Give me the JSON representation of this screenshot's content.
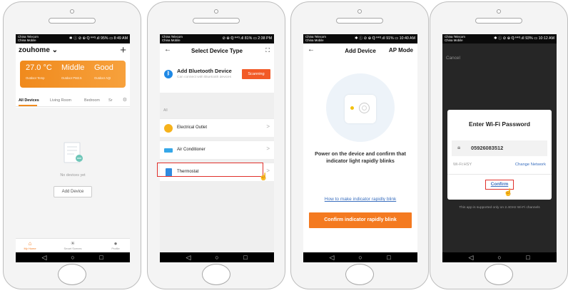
{
  "phones": [
    {
      "status": {
        "carrier": "China Telecom\nChina Mobile",
        "right": "✱ ⓘ ⊘ ⊕ ℚ ᴴ⁴ᴳ.ıll 95% ▭ 8:49 AM"
      },
      "home": {
        "title": "zouhome ⌄",
        "plus_icon": "+",
        "weather": [
          {
            "value": "27.0 °C",
            "label": "Outdoor Temp"
          },
          {
            "value": "Middle",
            "label": "Outdoor PM2.5"
          },
          {
            "value": "Good",
            "label": "Outdoor AQI"
          }
        ],
        "tabs": [
          "All Devices",
          "Living Room",
          "Bedroom",
          "Sr"
        ],
        "empty_text": "No devices yet",
        "add_device": "Add Device",
        "tabbar": [
          {
            "icon": "house-icon",
            "label": "My Home"
          },
          {
            "icon": "sun-icon",
            "label": "Smart Scenes"
          },
          {
            "icon": "person-icon",
            "label": "Profile"
          }
        ]
      }
    },
    {
      "status": {
        "carrier": "China Telecom\nChina Mobile",
        "right": "⊘ ⊕ ℚ ᴴ⁴ᴳ.ıll 81% ▭ 2:38 PM"
      },
      "select": {
        "back": "←",
        "title": "Select Device Type",
        "scan_icon": "scan-frame-icon",
        "bt_title": "Add Bluetooth Device",
        "bt_sub": "Can connect with Bluetooth devices",
        "scanning": "Scanning",
        "all": "All",
        "devices": [
          {
            "name": "Electrical Outlet",
            "icon": "outlet-icon",
            "color": "#f6b21b"
          },
          {
            "name": "Air Conditioner",
            "icon": "ac-icon",
            "color": "#36a7e8"
          },
          {
            "name": "Thermostat",
            "icon": "thermostat-icon",
            "color": "#2f8be0"
          }
        ]
      }
    },
    {
      "status": {
        "carrier": "China Telecom\nChina Mobile",
        "right": "✱ ⓘ ⊘ ⊕ ℚ ᴴ⁴ᴳ.ıll 91% ▭ 10:40 AM"
      },
      "add": {
        "back": "←",
        "title": "Add Device",
        "mode": "AP Mode",
        "instruction": "Power on the device and confirm that indicator light rapidly blinks",
        "howto": "How to make indicator rapidly blink",
        "confirm": "Confirm indicator rapidly blink"
      }
    },
    {
      "status": {
        "carrier": "China Telecom\nChina Mobile",
        "right": "✱ ⓘ ⊘ ⊕ ℚ ᴴ⁴ᴳ.ıll 93% ▭ 10:12 AM"
      },
      "wifi": {
        "cancel": "Cancel",
        "title": "Enter Wi-Fi Password",
        "password": "05926083512",
        "wifi_name": "Wi-Fi:HSY",
        "change": "Change Network",
        "confirm": "Confirm",
        "note": "This app is supported only on 2.4GHz Wi-Fi channels"
      }
    }
  ],
  "navbar": {
    "back": "◁",
    "home": "○",
    "recent": "□"
  },
  "colors": {
    "accent_orange": "#f47a20",
    "highlight_red": "#e0302b",
    "link_blue": "#3a6fbf"
  }
}
